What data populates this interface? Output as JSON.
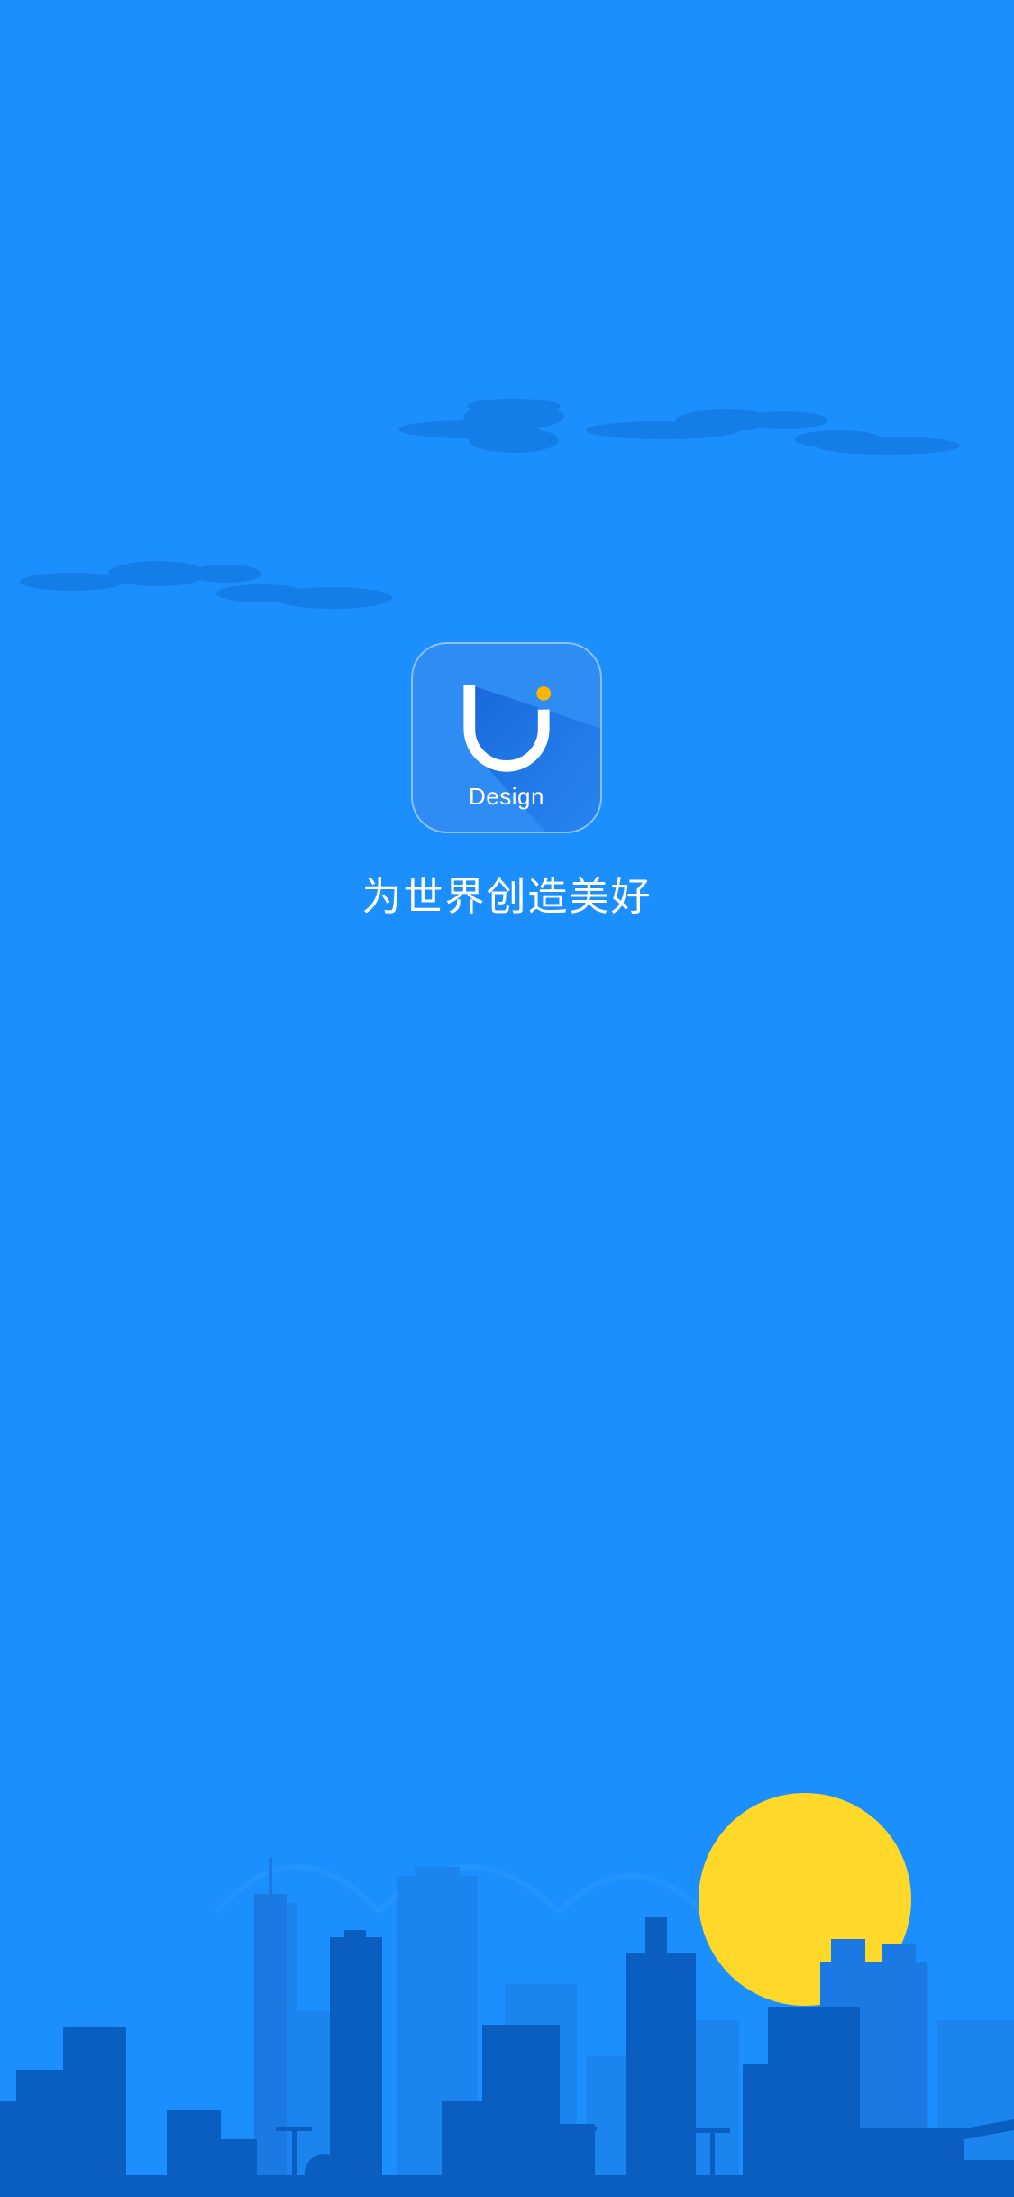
{
  "splash": {
    "icon_label": "Design",
    "tagline": "为世界创造美好"
  },
  "colors": {
    "background": "#1a8ffd",
    "cloud": "#1478e0",
    "building_back": "#1b84ee",
    "building_mid": "#1a79e3",
    "building_front": "#0a5ebf",
    "sun": "#ffd829",
    "icon_dot": "#ffb300"
  },
  "icons": {
    "app_icon": "u-design-logo-icon"
  }
}
